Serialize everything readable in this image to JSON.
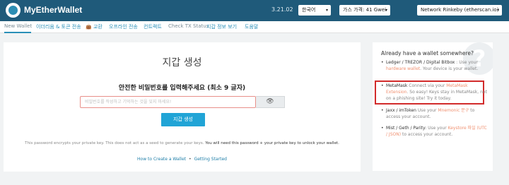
{
  "header": {
    "logo_text": "MyEtherWallet",
    "version": "3.21.02",
    "language": "한국어",
    "gas_price": "가스 가격: 41 Gwei",
    "network": "Network Rinkeby (etherscan.io)"
  },
  "nav": {
    "items": [
      "New Wallet",
      "이더리움 & 토큰 전송",
      "교환",
      "오프라인 전송",
      "컨트랙트",
      "Check TX Status",
      "지갑 정보 보기",
      "도움말"
    ],
    "active_index": 0
  },
  "main": {
    "title": "지갑 생성",
    "subtitle": "안전한 비밀번호를 입력해주세요 (최소 9 글자)",
    "password_placeholder": "비밀번호를 작성하고 기억하는 것을 잊지 마세요!",
    "generate_button": "지갑 생성",
    "info_text": "This password encrypts your private key. This does not act as a seed to generate your keys.",
    "info_bold": "You will need this password + your private key to unlock your wallet.",
    "link_how_to": "How to Create a Wallet",
    "link_separator": "•",
    "link_getting_started": "Getting Started"
  },
  "sidebar": {
    "question_mark": "?",
    "title": "Already have a wallet somewhere?",
    "items": [
      {
        "name": "Ledger / TREZOR / Digital Bitbox",
        "pre": ": Use your",
        "link": "hardware wallet",
        "post": ". Your device is your wallet."
      },
      {
        "name": "MetaMask",
        "pre": "Connect via your",
        "link": "MetaMask Extension",
        "post": ". So easy! Keys stay in MetaMask, not on a phishing site! Try it today."
      },
      {
        "name": "Jaxx / imToken",
        "pre": "Use your",
        "link": "Mnemonic 문구",
        "post": "to access your account."
      },
      {
        "name": "Mist / Geth / Parity:",
        "pre": "Use your",
        "link": "Keystore 파일 (UTC / JSON)",
        "post": "to access your account."
      }
    ]
  },
  "colors": {
    "header_bg": "#1f5a7a",
    "accent": "#21a4d6",
    "link": "#2a8fb8",
    "highlight_border": "#d22b2b",
    "sidebar_link": "#f09070"
  }
}
